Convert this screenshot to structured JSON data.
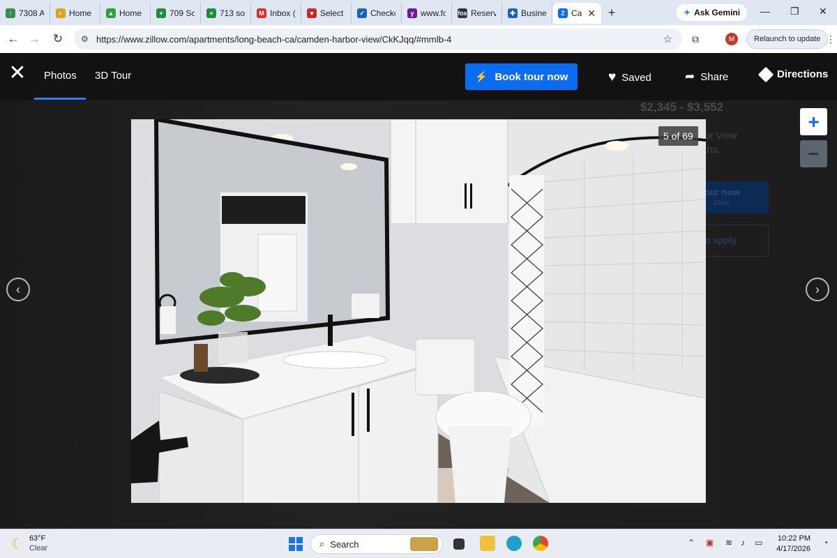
{
  "browser": {
    "tabs": [
      {
        "label": "7308 A",
        "color": "#3a8a4a",
        "glyph": "↑"
      },
      {
        "label": "Home",
        "color": "#e0a020",
        "glyph": "◐"
      },
      {
        "label": "Home",
        "color": "#2f9e44",
        "glyph": "▲"
      },
      {
        "label": "709 So",
        "color": "#1e8e3e",
        "glyph": "+"
      },
      {
        "label": "713 so",
        "color": "#1e8e3e",
        "glyph": "+"
      },
      {
        "label": "Inbox (",
        "color": "#d93025",
        "glyph": "M"
      },
      {
        "label": "Select",
        "color": "#c62828",
        "glyph": "♥"
      },
      {
        "label": "Checkc",
        "color": "#1565c0",
        "glyph": "✓"
      },
      {
        "label": "www.fc",
        "color": "#6a1b9a",
        "glyph": "y"
      },
      {
        "label": "Reserv",
        "color": "#333333",
        "glyph": "fox"
      },
      {
        "label": "Busine",
        "color": "#1565c0",
        "glyph": "✚"
      }
    ],
    "active_tab": {
      "label": "Ca",
      "color": "#0a6cf0",
      "glyph": "Z"
    },
    "ask_gemini": "Ask Gemini",
    "url": "https://www.zillow.com/apartments/long-beach-ca/camden-harbor-view/CkKJqq/#mmlb-4",
    "avatar_letter": "M",
    "relaunch": "Relaunch to update"
  },
  "viewer": {
    "tab_photos": "Photos",
    "tab_3d": "3D Tour",
    "book_button": "Book tour now",
    "saved": "Saved",
    "share": "Share",
    "directions": "Directions",
    "counter": "5 of 69",
    "zoom_in": "+",
    "zoom_out": "−",
    "background_price": "$2,345 - $3,552",
    "background_text_1": "or View",
    "background_text_2": "ths,",
    "background_btn": "our now",
    "background_btn_sub": "45pm",
    "background_btn2": "o apply",
    "prev_glyph": "‹",
    "next_glyph": "›"
  },
  "taskbar": {
    "temp": "63°F",
    "condition": "Clear",
    "search": "Search",
    "time": "10:22 PM",
    "date": "4/17/2026"
  },
  "colors": {
    "accent": "#0a6cf0",
    "viewer_bg": "#121212"
  }
}
